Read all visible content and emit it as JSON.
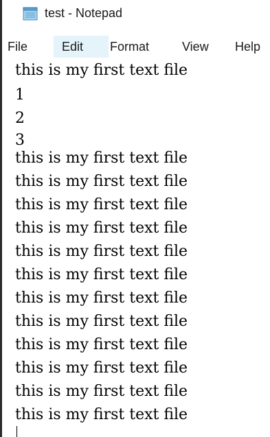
{
  "window": {
    "title": "test - Notepad",
    "icon": "notepad-icon"
  },
  "menu": {
    "items": [
      {
        "label": "File"
      },
      {
        "label": "Edit"
      },
      {
        "label": "Format"
      },
      {
        "label": "View"
      },
      {
        "label": "Help"
      }
    ],
    "highlighted": "Edit",
    "highlight_color": "#e5f3fb"
  },
  "editor": {
    "lines": [
      "this is my first text file",
      "1",
      "2",
      "3",
      "this is my first text file",
      "this is my first text file",
      "this is my first text file",
      "this is my first text file",
      "this is my first text file",
      "this is my first text file",
      "this is my first text file",
      "this is my first text file",
      "this is my first text file",
      "this is my first text file",
      "this is my first text file",
      "this is my first text file"
    ]
  }
}
